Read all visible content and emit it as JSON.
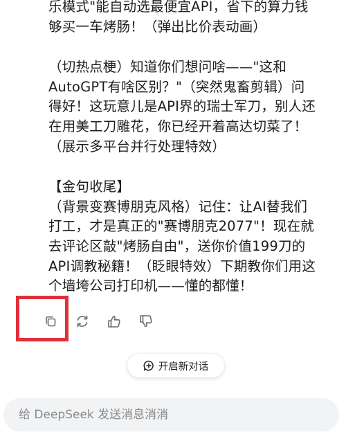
{
  "message": {
    "lines_p1": [
      "乐模式\"能自动选最便宜API，省下的算力钱",
      "够买一车烤肠！（弹出比价表动画）"
    ],
    "lines_p2": [
      "（切热点梗）知道你们想问啥——\"这和",
      "AutoGPT有啥区别？\"（突然鬼畜剪辑）问",
      "得好！这玩意儿是API界的瑞士军刀，别人还",
      "在用美工刀雕花，你已经开着高达切菜了！",
      "（展示多平台并行处理特效）"
    ],
    "lines_p3": [
      "【金句收尾】",
      "（背景变赛博朋克风格）记住：让AI替我们",
      "打工，才是真正的\"赛博朋克2077\"！现在就",
      "去评论区敲\"烤肠自由\"，送你价值199刀的",
      "API调教秘籍！（眨眼特效）下期教你们用这",
      "个墙垮公司打印机——懂的都懂！"
    ]
  },
  "actions": {
    "copy": "copy-icon",
    "regenerate": "refresh-icon",
    "like": "thumbs-up-icon",
    "dislike": "thumbs-down-icon"
  },
  "new_chat": {
    "label": "开启新对话"
  },
  "input": {
    "placeholder": "给 DeepSeek 发送消息消消"
  },
  "colors": {
    "highlight": "#e0303a",
    "icon": "#6b6b6b",
    "input_bg": "#f2f3f5"
  }
}
